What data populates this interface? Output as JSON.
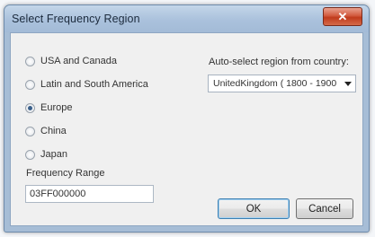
{
  "window": {
    "title": "Select Frequency Region",
    "close_symbol": "✕"
  },
  "regions": [
    {
      "label": "USA and Canada",
      "checked": false
    },
    {
      "label": "Latin and South America",
      "checked": false
    },
    {
      "label": "Europe",
      "checked": true
    },
    {
      "label": "China",
      "checked": false
    },
    {
      "label": "Japan",
      "checked": false
    }
  ],
  "frequency": {
    "label": "Frequency Range",
    "value": "03FF000000"
  },
  "auto_select": {
    "label": "Auto-select region from country:",
    "selected": "UnitedKingdom ( 1800 - 1900"
  },
  "buttons": {
    "ok": "OK",
    "cancel": "Cancel"
  }
}
